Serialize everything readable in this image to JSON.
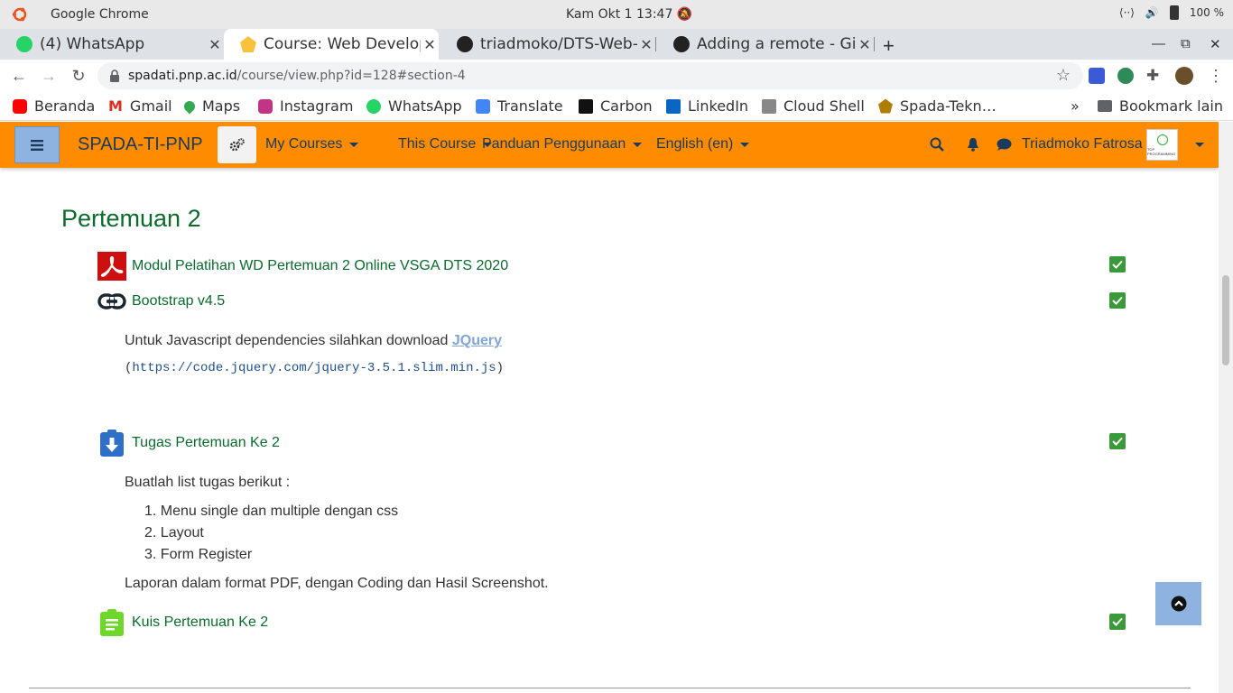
{
  "os": {
    "app_name": "Google Chrome",
    "clock": "Kam Okt 1  13:47",
    "battery": "100 %"
  },
  "tabs": [
    {
      "title": "(4) WhatsApp",
      "icon": "whatsapp-icon"
    },
    {
      "title": "Course: Web Develope",
      "icon": "moodle-icon"
    },
    {
      "title": "triadmoko/DTS-Web-D",
      "icon": "github-icon"
    },
    {
      "title": "Adding a remote - GitH",
      "icon": "github-icon"
    }
  ],
  "address": {
    "host": "spadati.pnp.ac.id",
    "path": "/course/view.php?id=128#section-4"
  },
  "bookmarks": [
    {
      "label": "Beranda",
      "color": "#ff0000"
    },
    {
      "label": "Gmail",
      "color": "#d93025"
    },
    {
      "label": "Maps",
      "color": "#34a853"
    },
    {
      "label": "Instagram",
      "color": "#c13584"
    },
    {
      "label": "WhatsApp",
      "color": "#25d366"
    },
    {
      "label": "Translate",
      "color": "#4285f4"
    },
    {
      "label": "Carbon",
      "color": "#111111"
    },
    {
      "label": "LinkedIn",
      "color": "#0a66c2"
    },
    {
      "label": "Cloud Shell",
      "color": "#888888"
    },
    {
      "label": "Spada-Tekn…",
      "color": "#b07d00"
    }
  ],
  "bookmarks_overflow": "»",
  "bookmarks_other": "Bookmark lain",
  "navbar": {
    "brand": "SPADA-TI-PNP",
    "menus": [
      "My Courses",
      "This Course",
      "Panduan Penggunaan",
      "English (en)"
    ],
    "user": "Triadmoko Fatrosa",
    "avatar_text": "TOP PROGRAMMING",
    "color": "#ff8c00"
  },
  "section": {
    "title": "Pertemuan 2",
    "activities": [
      {
        "label": "Modul Pelatihan WD Pertemuan 2 Online VSGA DTS 2020",
        "icon": "pdf-icon"
      },
      {
        "label": "Bootstrap v4.5",
        "icon": "url-link-icon"
      },
      {
        "label": "Tugas Pertemuan Ke 2",
        "icon": "assignment-icon"
      },
      {
        "label": "Kuis Pertemuan Ke 2",
        "icon": "quiz-icon"
      }
    ],
    "bootstrap_desc": {
      "text": "Untuk Javascript dependencies silahkan download ",
      "link": "JQuery",
      "paren_open": "(",
      "code": "https://code.jquery.com/jquery-3.5.1.slim.min.js",
      "paren_close": ")"
    },
    "tugas_desc": {
      "intro": "Buatlah list tugas berikut :",
      "items": [
        "1.  Menu single dan multiple dengan css",
        "2.  Layout",
        "3.  Form Register"
      ],
      "outro": "Laporan dalam format PDF, dengan Coding dan Hasil Screenshot."
    }
  }
}
